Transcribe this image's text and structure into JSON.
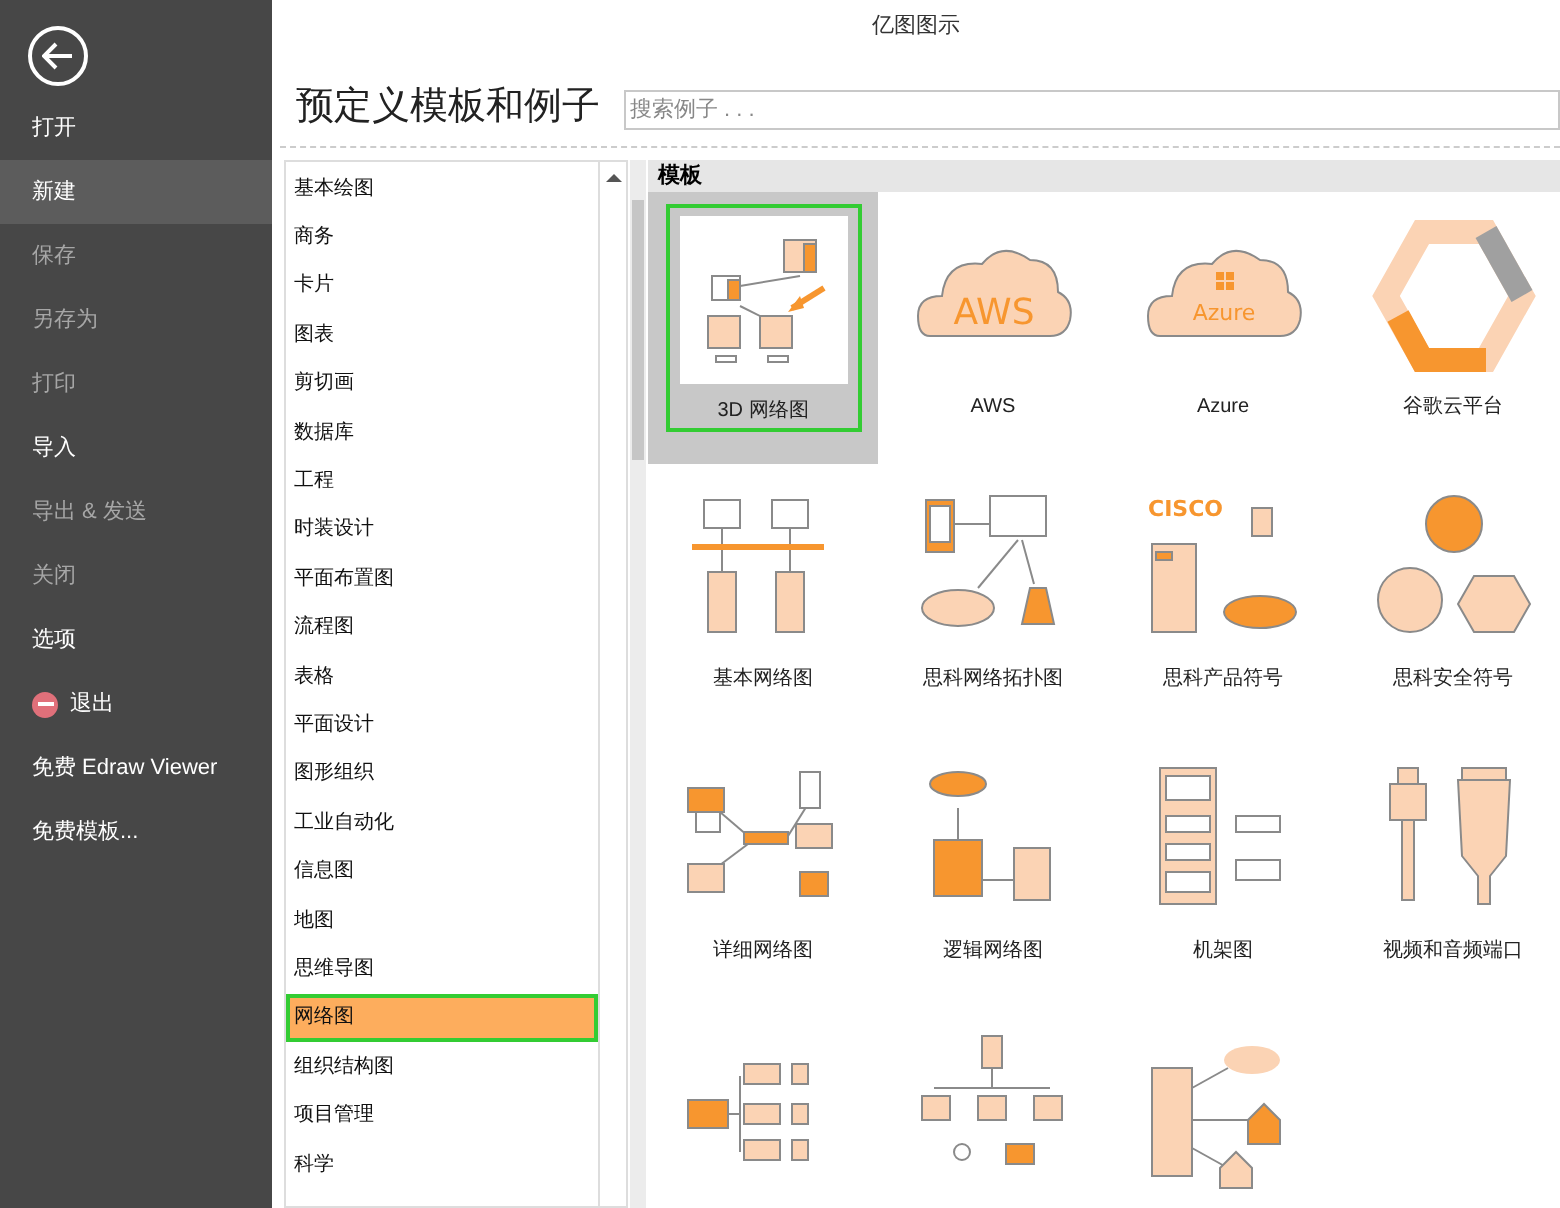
{
  "window": {
    "title": "亿图图示"
  },
  "sidebar": {
    "items": [
      {
        "label": "打开",
        "disabled": false,
        "selected": false,
        "kind": "text"
      },
      {
        "label": "新建",
        "disabled": false,
        "selected": true,
        "kind": "text"
      },
      {
        "label": "保存",
        "disabled": true,
        "selected": false,
        "kind": "text"
      },
      {
        "label": "另存为",
        "disabled": true,
        "selected": false,
        "kind": "text"
      },
      {
        "label": "打印",
        "disabled": true,
        "selected": false,
        "kind": "text"
      },
      {
        "label": "导入",
        "disabled": false,
        "selected": false,
        "kind": "text"
      },
      {
        "label": "导出 & 发送",
        "disabled": true,
        "selected": false,
        "kind": "text"
      },
      {
        "label": "关闭",
        "disabled": true,
        "selected": false,
        "kind": "text"
      },
      {
        "label": "选项",
        "disabled": false,
        "selected": false,
        "kind": "text"
      },
      {
        "label": "退出",
        "disabled": false,
        "selected": false,
        "kind": "exit"
      },
      {
        "label": "免费 Edraw Viewer",
        "disabled": false,
        "selected": false,
        "kind": "text"
      },
      {
        "label": "免费模板...",
        "disabled": false,
        "selected": false,
        "kind": "text"
      }
    ]
  },
  "heading": "预定义模板和例子",
  "search": {
    "placeholder": "搜索例子 . . ."
  },
  "categories": [
    {
      "label": "基本绘图",
      "selected": false
    },
    {
      "label": "商务",
      "selected": false
    },
    {
      "label": "卡片",
      "selected": false
    },
    {
      "label": "图表",
      "selected": false
    },
    {
      "label": "剪切画",
      "selected": false
    },
    {
      "label": "数据库",
      "selected": false
    },
    {
      "label": "工程",
      "selected": false
    },
    {
      "label": "时装设计",
      "selected": false
    },
    {
      "label": "平面布置图",
      "selected": false
    },
    {
      "label": "流程图",
      "selected": false
    },
    {
      "label": "表格",
      "selected": false
    },
    {
      "label": "平面设计",
      "selected": false
    },
    {
      "label": "图形组织",
      "selected": false
    },
    {
      "label": "工业自动化",
      "selected": false
    },
    {
      "label": "信息图",
      "selected": false
    },
    {
      "label": "地图",
      "selected": false
    },
    {
      "label": "思维导图",
      "selected": false
    },
    {
      "label": "网络图",
      "selected": true
    },
    {
      "label": "组织结构图",
      "selected": false
    },
    {
      "label": "项目管理",
      "selected": false
    },
    {
      "label": "科学",
      "selected": false
    }
  ],
  "templates": {
    "header": "模板",
    "items": [
      {
        "label": "3D 网络图",
        "selected": true
      },
      {
        "label": "AWS",
        "selected": false,
        "icon_text": "AWS"
      },
      {
        "label": "Azure",
        "selected": false,
        "icon_text": "Azure"
      },
      {
        "label": "谷歌云平台",
        "selected": false
      },
      {
        "label": "基本网络图",
        "selected": false
      },
      {
        "label": "思科网络拓扑图",
        "selected": false
      },
      {
        "label": "思科产品符号",
        "selected": false,
        "icon_text": "CISCO"
      },
      {
        "label": "思科安全符号",
        "selected": false
      },
      {
        "label": "详细网络图",
        "selected": false
      },
      {
        "label": "逻辑网络图",
        "selected": false
      },
      {
        "label": "机架图",
        "selected": false
      },
      {
        "label": "视频和音频端口",
        "selected": false
      },
      {
        "selected": false
      },
      {
        "selected": false
      },
      {
        "selected": false
      }
    ]
  }
}
